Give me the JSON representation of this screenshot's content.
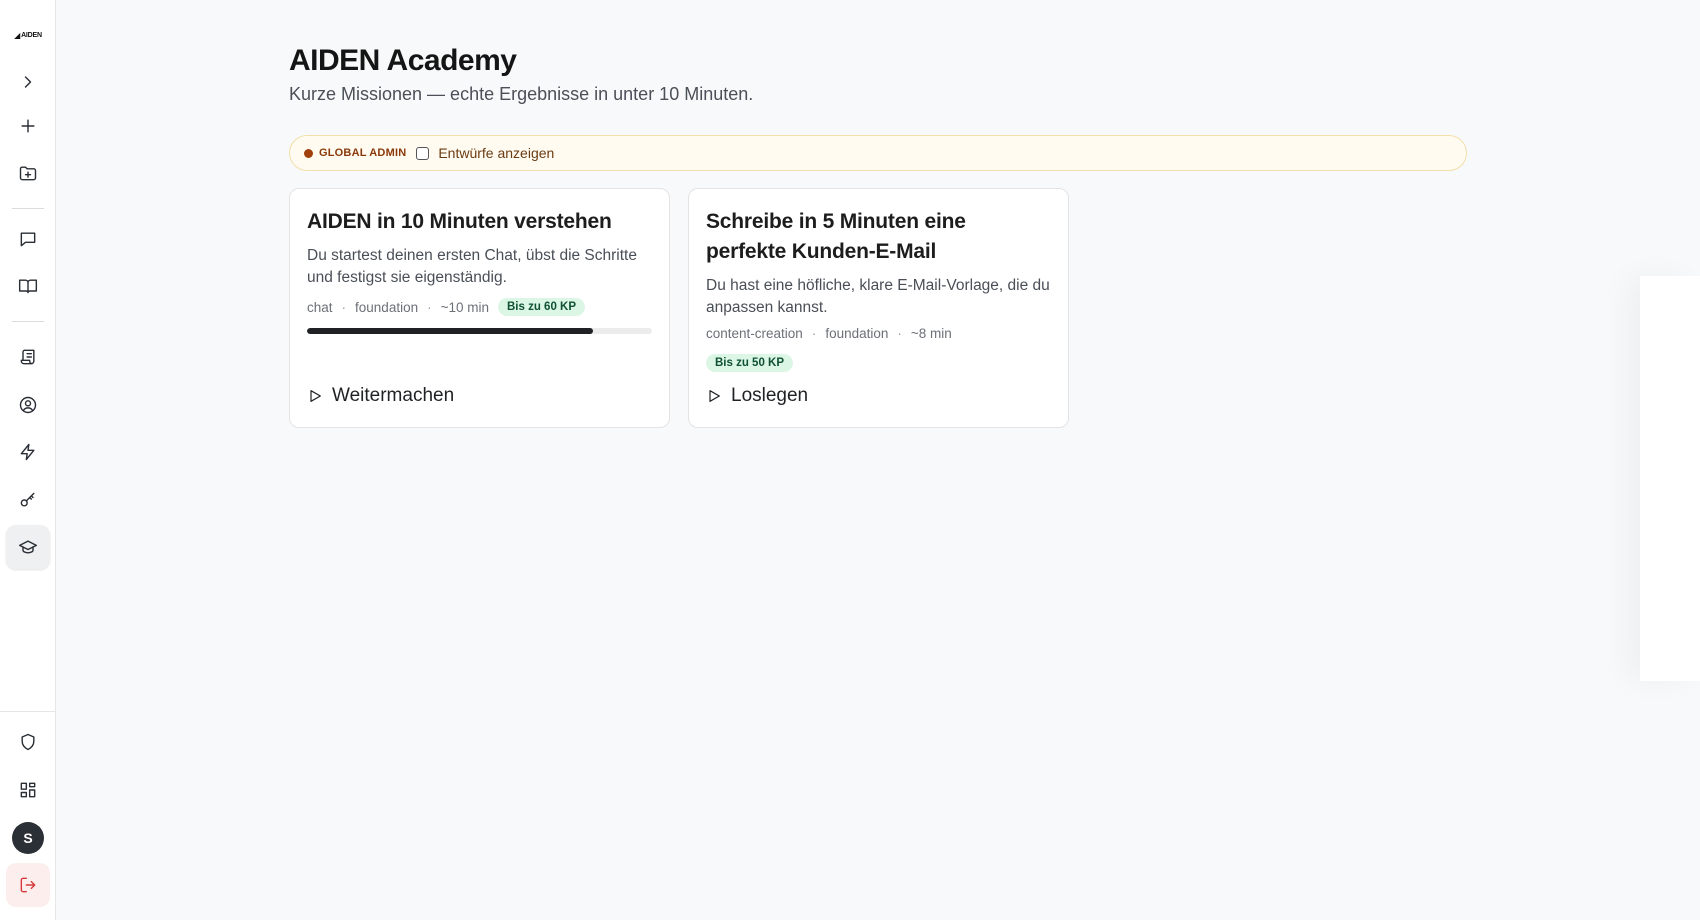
{
  "sidebar": {
    "logo_text": "AIDEN",
    "items": [
      {
        "icon": "chevron-right-icon"
      },
      {
        "icon": "plus-icon"
      },
      {
        "icon": "folder-plus-icon"
      },
      {
        "icon": "message-icon"
      },
      {
        "icon": "book-open-icon"
      },
      {
        "icon": "scroll-icon"
      },
      {
        "icon": "user-circle-icon"
      },
      {
        "icon": "lightning-icon"
      },
      {
        "icon": "key-icon"
      },
      {
        "icon": "graduation-cap-icon",
        "active": true
      },
      {
        "icon": "shield-icon"
      },
      {
        "icon": "dashboard-grid-icon"
      },
      {
        "icon": "logout-icon"
      }
    ],
    "avatar_initial": "S"
  },
  "header": {
    "title": "AIDEN Academy",
    "subtitle": "Kurze Missionen — echte Ergebnisse in unter 10 Minuten."
  },
  "admin_bar": {
    "badge": "GLOBAL ADMIN",
    "checkbox_label": "Entwürfe anzeigen",
    "checked": false
  },
  "missions": [
    {
      "title": "AIDEN in 10 Minuten verstehen",
      "description": "Du startest deinen ersten Chat, übst die Schritte und festigst sie eigenständig.",
      "category": "chat",
      "level": "foundation",
      "duration": "~10 min",
      "kp": "Bis zu 60 KP",
      "progress": 0.83,
      "action": "Weitermachen"
    },
    {
      "title": "Schreibe in 5 Minuten eine perfekte Kunden-E-Mail",
      "description": "Du hast eine höfliche, klare E-Mail-Vorlage, die du anpassen kannst.",
      "category": "content-creation",
      "level": "foundation",
      "duration": "~8 min",
      "kp": "Bis zu 50 KP",
      "action": "Loslegen"
    }
  ],
  "colors": {
    "accent_dark": "#1f2124",
    "kp_badge_bg": "#dcf6e6",
    "admin_bar_bg": "#fffbf0",
    "logout_red": "#d63b3b"
  }
}
